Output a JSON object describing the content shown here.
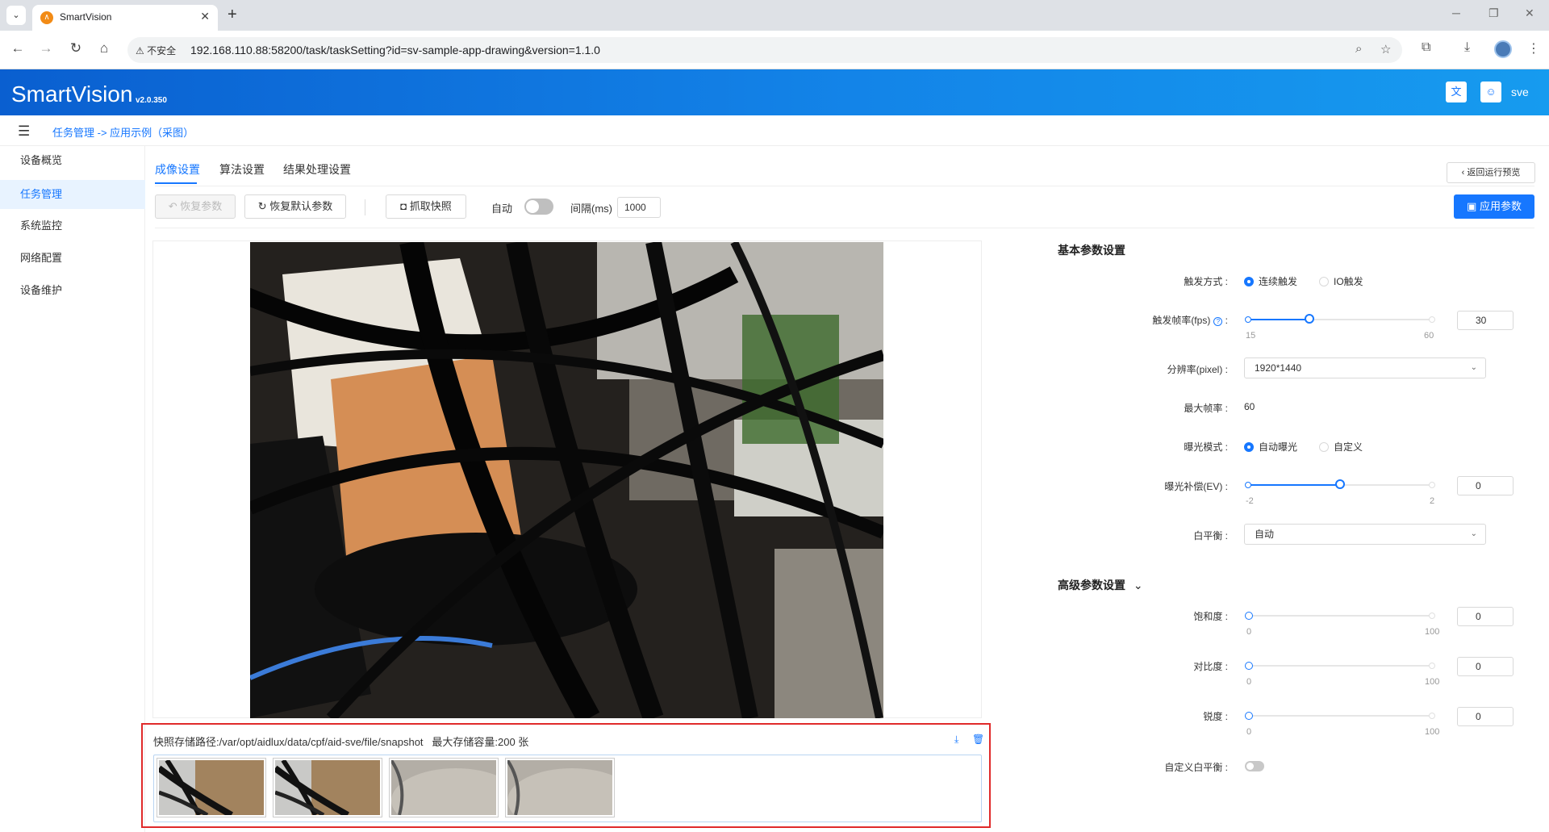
{
  "browser": {
    "tab_title": "SmartVision",
    "security_label": "不安全",
    "url": "192.168.110.88:58200/task/taskSetting?id=sv-sample-app-drawing&version=1.1.0"
  },
  "app": {
    "brand": "SmartVision",
    "version": "v2.0.350",
    "username": "sve",
    "breadcrumb": "任务管理 -> 应用示例（采图）"
  },
  "sidebar": {
    "items": [
      {
        "label": "设备概览"
      },
      {
        "label": "任务管理"
      },
      {
        "label": "系统监控"
      },
      {
        "label": "网络配置"
      },
      {
        "label": "设备维护"
      }
    ]
  },
  "page_tabs": [
    "成像设置",
    "算法设置",
    "结果处理设置"
  ],
  "back_button": "返回运行预览",
  "toolbar": {
    "restore_params": "恢复参数",
    "restore_default": "恢复默认参数",
    "capture": "抓取快照",
    "auto_label": "自动",
    "interval_label": "间隔(ms)",
    "interval_value": "1000",
    "apply": "应用参数"
  },
  "snapshot": {
    "path_text": "快照存储路径:/var/opt/aidlux/data/cpf/aid-sve/file/snapshot",
    "capacity_text": "最大存储容量:200 张",
    "count": 4
  },
  "basic_settings": {
    "title": "基本参数设置",
    "trigger_label": "触发方式 :",
    "trigger_options": [
      "连续触发",
      "IO触发"
    ],
    "fps_label": "触发帧率(fps)",
    "fps_min": "15",
    "fps_max": "60",
    "fps_value": "30",
    "resolution_label": "分辨率(pixel) :",
    "resolution_value": "1920*1440",
    "maxfps_label": "最大帧率 :",
    "maxfps_value": "60",
    "exposure_label": "曝光模式 :",
    "exposure_options": [
      "自动曝光",
      "自定义"
    ],
    "ev_label": "曝光补偿(EV) :",
    "ev_min": "-2",
    "ev_max": "2",
    "ev_value": "0",
    "wb_label": "白平衡 :",
    "wb_value": "自动"
  },
  "advanced_settings": {
    "title": "高级参数设置",
    "saturation_label": "饱和度 :",
    "contrast_label": "对比度 :",
    "sharpness_label": "锐度 :",
    "range_min": "0",
    "range_max": "100",
    "saturation_value": "0",
    "contrast_value": "0",
    "sharpness_value": "0",
    "custom_wb_label": "自定义白平衡 :"
  },
  "colors": {
    "accent": "#1677ff",
    "header_start": "#0a5fd0",
    "header_end": "#169bef",
    "highlight_border": "#e02a2a"
  }
}
